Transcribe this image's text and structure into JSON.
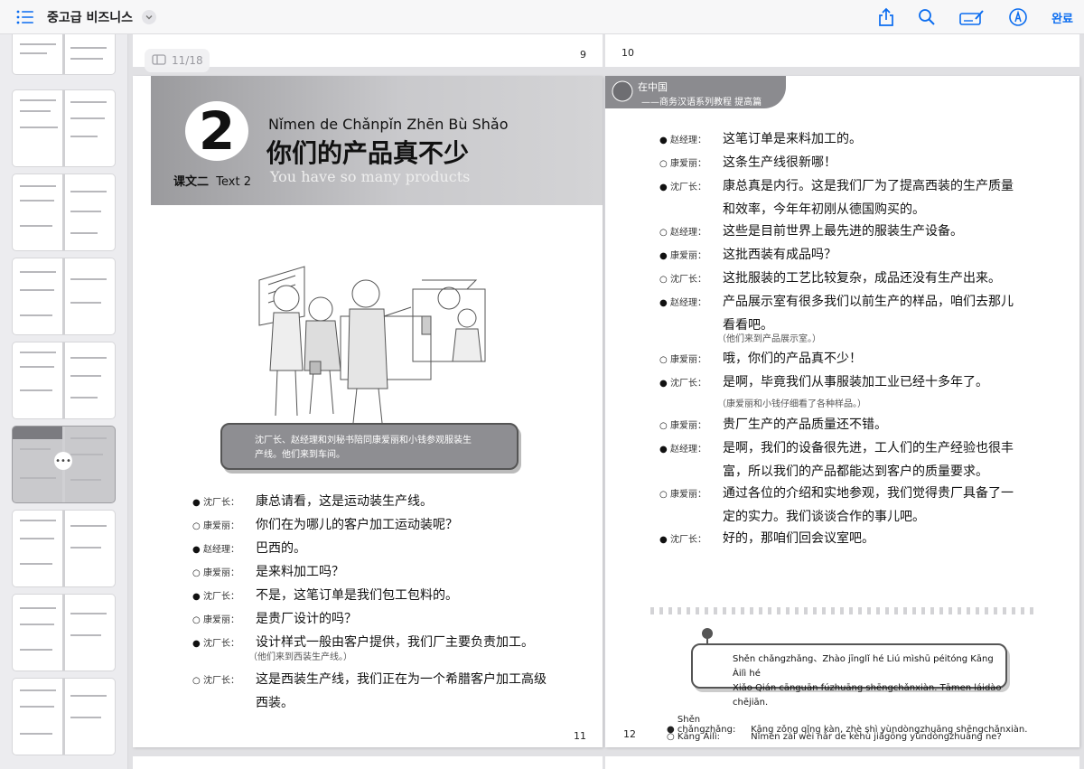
{
  "toolbar": {
    "title": "중고급 비즈니스",
    "done_label": "완료",
    "icons": [
      "list-icon",
      "chevron-down-icon",
      "share-icon",
      "search-icon",
      "markup-icon",
      "pen-icon"
    ]
  },
  "viewer": {
    "page_indicator": "11/18",
    "strip_left_number": "9",
    "strip_right_number": "10",
    "left_page_number": "11",
    "right_page_number": "12"
  },
  "left_page": {
    "lesson_number": "2",
    "pinyin_title": "Nǐmen de Chǎnpǐn Zhēn Bù Shǎo",
    "cn_title": "你们的产品真不少",
    "lesson_label_cn": "课文二",
    "lesson_label_en": "Text 2",
    "en_title": "You have so many products",
    "scene_line1": "沈厂长、赵经理和刘秘书陪同康爱丽和小钱参观服装生",
    "scene_line2": "产线。他们来到车间。",
    "dialogue": [
      {
        "marker": "●",
        "speaker": "沈厂长：",
        "text": "康总请看，这是运动装生产线。"
      },
      {
        "marker": "○",
        "speaker": "康爱丽：",
        "text": "你们在为哪儿的客户加工运动装呢？"
      },
      {
        "marker": "●",
        "speaker": "赵经理：",
        "text": "巴西的。"
      },
      {
        "marker": "○",
        "speaker": "康爱丽：",
        "text": "是来料加工吗？"
      },
      {
        "marker": "●",
        "speaker": "沈厂长：",
        "text": "不是，这笔订单是我们包工包料的。"
      },
      {
        "marker": "○",
        "speaker": "康爱丽：",
        "text": "是贵厂设计的吗？"
      },
      {
        "marker": "●",
        "speaker": "沈厂长：",
        "text": "设计样式一般由客户提供，我们厂主要负责加工。"
      }
    ],
    "note1": "（他们来到西装生产线。）",
    "last_marker": "○",
    "last_speaker": "沈厂长：",
    "last_line1": "这是西装生产线，我们正在为一个希腊客户加工高级",
    "last_line2": "西装。"
  },
  "right_page": {
    "header_a": "在中国",
    "header_b": "——商务汉语系列教程  提高篇",
    "dialogue": [
      {
        "marker": "●",
        "speaker": "赵经理：",
        "text": "这笔订单是来料加工的。"
      },
      {
        "marker": "○",
        "speaker": "康爱丽：",
        "text": "这条生产线很新哪！"
      },
      {
        "marker": "●",
        "speaker": "沈厂长：",
        "text": "康总真是内行。这是我们厂为了提高西装的生产质量"
      },
      {
        "marker": "",
        "speaker": "",
        "text": "和效率，今年年初刚从德国购买的。"
      },
      {
        "marker": "○",
        "speaker": "赵经理：",
        "text": "这些是目前世界上最先进的服装生产设备。"
      },
      {
        "marker": "●",
        "speaker": "康爱丽：",
        "text": "这批西装有成品吗？"
      },
      {
        "marker": "○",
        "speaker": "沈厂长：",
        "text": "这批服装的工艺比较复杂，成品还没有生产出来。"
      },
      {
        "marker": "●",
        "speaker": "赵经理：",
        "text": "产品展示室有很多我们以前生产的样品，咱们去那儿"
      },
      {
        "marker": "",
        "speaker": "",
        "text": "看看吧。"
      }
    ],
    "note1": "（他们来到产品展示室。）",
    "dialogue2": [
      {
        "marker": "○",
        "speaker": "康爱丽：",
        "text": "哦，你们的产品真不少！"
      },
      {
        "marker": "●",
        "speaker": "沈厂长：",
        "text": "是啊，毕竟我们从事服装加工业已经十多年了。"
      }
    ],
    "note2": "（康爱丽和小钱仔细看了各种样品。）",
    "dialogue3": [
      {
        "marker": "○",
        "speaker": "康爱丽：",
        "text": "贵厂生产的产品质量还不错。"
      },
      {
        "marker": "●",
        "speaker": "赵经理：",
        "text": "是啊，我们的设备很先进，工人们的生产经验也很丰"
      },
      {
        "marker": "",
        "speaker": "",
        "text": "富，所以我们的产品都能达到客户的质量要求。"
      },
      {
        "marker": "○",
        "speaker": "康爱丽：",
        "text": "通过各位的介绍和实地参观，我们觉得贵厂具备了一"
      },
      {
        "marker": "",
        "speaker": "",
        "text": "定的实力。我们谈谈合作的事儿吧。"
      },
      {
        "marker": "●",
        "speaker": "沈厂长：",
        "text": "好的，那咱们回会议室吧。"
      }
    ],
    "pinyin_box_line1": "Shěn chǎngzhǎng、Zhào jīnglǐ hé Liú mìshū péitóng Kāng Àilì hé",
    "pinyin_box_line2": "Xiǎo Qián cānguān fúzhuāng shēngchǎnxiàn. Tāmen láidào chējiān.",
    "pinyin_lines": [
      {
        "marker": "●",
        "speaker": "Shěn chǎngzhǎng:",
        "text": "Kāng zǒng qǐng kàn, zhè shì yùndòngzhuāng shēngchǎnxiàn."
      },
      {
        "marker": "○",
        "speaker": "Kāng Àilì:",
        "text": "Nǐmen zài wèi nǎr de kèhù jiāgōng yùndòngzhuāng ne?"
      }
    ]
  }
}
